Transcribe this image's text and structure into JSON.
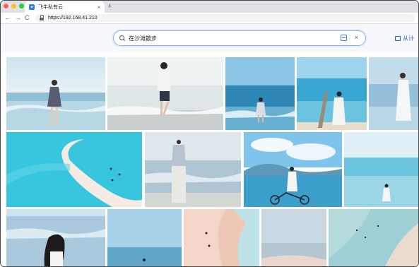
{
  "browser": {
    "tab_title": "飞牛私有云",
    "tab_close": "×",
    "new_tab": "+",
    "url": "https://192.168.41.210",
    "back": "←",
    "forward": "→",
    "reload": "C"
  },
  "search": {
    "query": "在沙滩散步",
    "clear": "×"
  },
  "header": {
    "upload_label": "从计"
  },
  "icons": {
    "search": "search-icon",
    "scan": "scan-image-icon",
    "clear": "close-icon",
    "upload": "upload-icon",
    "lock": "lock-icon"
  },
  "colors": {
    "accent": "#2a5bd7",
    "search_border": "#8fb0ea",
    "header_bg": "#f6f8fc"
  }
}
